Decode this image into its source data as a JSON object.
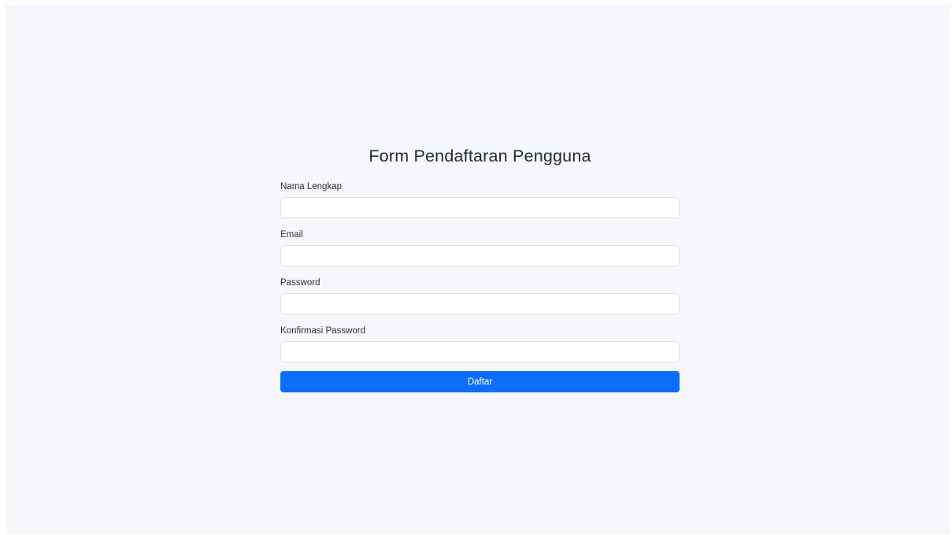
{
  "form": {
    "title": "Form Pendaftaran Pengguna",
    "fields": [
      {
        "label": "Nama Lengkap",
        "value": "",
        "placeholder": ""
      },
      {
        "label": "Email",
        "value": "",
        "placeholder": ""
      },
      {
        "label": "Password",
        "value": "",
        "placeholder": ""
      },
      {
        "label": "Konfirmasi Password",
        "value": "",
        "placeholder": ""
      }
    ],
    "submit_label": "Daftar"
  },
  "colors": {
    "background": "#f5f7fa",
    "primary": "#0d6efd",
    "input_border": "#dee2e6"
  }
}
